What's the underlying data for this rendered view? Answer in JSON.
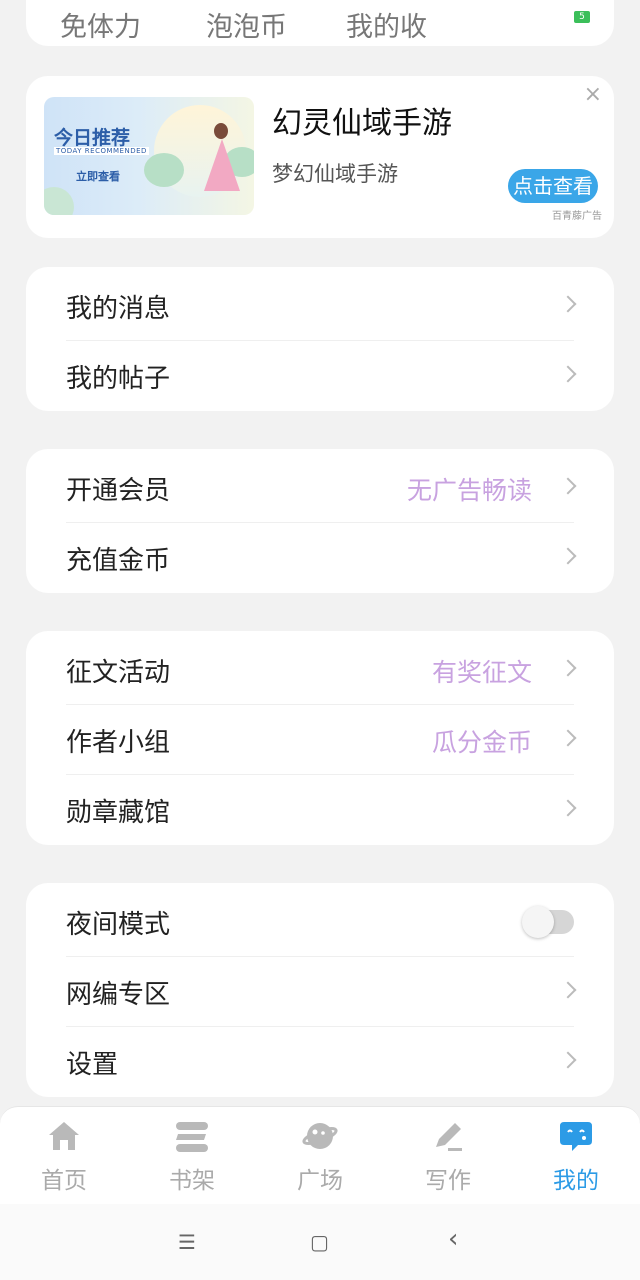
{
  "stats": {
    "items": [
      "免体力值",
      "泡泡币",
      "我的收入"
    ],
    "battery_label": "5"
  },
  "ad": {
    "image_title": "今日推荐",
    "image_subtitle": "TODAY RECOMMENDED",
    "image_cta": "立即查看",
    "title": "幻灵仙域手游",
    "subtitle": "梦幻仙域手游",
    "button": "点击查看",
    "source": "百青藤广告",
    "close": "×"
  },
  "group1": [
    {
      "label": "我的消息",
      "hint": ""
    },
    {
      "label": "我的帖子",
      "hint": ""
    }
  ],
  "group2": [
    {
      "label": "开通会员",
      "hint": "无广告畅读"
    },
    {
      "label": "充值金币",
      "hint": ""
    }
  ],
  "group3": [
    {
      "label": "征文活动",
      "hint": "有奖征文"
    },
    {
      "label": "作者小组",
      "hint": "瓜分金币"
    },
    {
      "label": "勋章藏馆",
      "hint": ""
    }
  ],
  "group4": [
    {
      "label": "夜间模式",
      "toggle": false
    },
    {
      "label": "网编专区"
    },
    {
      "label": "设置"
    }
  ],
  "tabs": [
    {
      "label": "首页",
      "icon": "home-icon"
    },
    {
      "label": "书架",
      "icon": "bookshelf-icon"
    },
    {
      "label": "广场",
      "icon": "planet-icon"
    },
    {
      "label": "写作",
      "icon": "pen-icon"
    },
    {
      "label": "我的",
      "icon": "chat-face-icon",
      "active": true
    }
  ],
  "system_nav": {
    "menu": "☰",
    "home": "▢",
    "back": "‹"
  },
  "colors": {
    "accent": "#2c9be6",
    "hint": "#c8a2e0",
    "tab_inactive": "#aaaaaa",
    "ad_button": "#3aa6e8"
  }
}
